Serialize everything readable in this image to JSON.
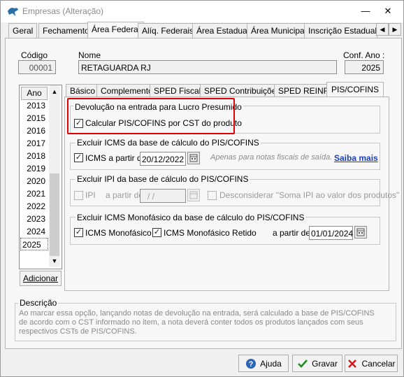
{
  "window": {
    "title": "Empresas (Alteração)"
  },
  "main_tabs": [
    {
      "label": "Geral"
    },
    {
      "label": "Fechamento"
    },
    {
      "label": "Área Federal",
      "active": true
    },
    {
      "label": "Alíq. Federais"
    },
    {
      "label": "Área Estadual"
    },
    {
      "label": "Área Municipal"
    },
    {
      "label": "Inscrição Estadual S"
    }
  ],
  "header": {
    "codigo_label": "Código",
    "codigo_value": "00001",
    "nome_label": "Nome",
    "nome_value": "RETAGUARDA RJ",
    "conf_ano_label": "Conf. Ano :",
    "conf_ano_value": "2025"
  },
  "ano_list": {
    "header": "Ano",
    "items": [
      "2013",
      "2015",
      "2016",
      "2017",
      "2018",
      "2019",
      "2020",
      "2021",
      "2022",
      "2023",
      "2024",
      "2025"
    ],
    "selected": "2025",
    "add_button": "Adicionar"
  },
  "sub_tabs": [
    {
      "label": "Básico"
    },
    {
      "label": "Complemento"
    },
    {
      "label": "SPED Fiscal"
    },
    {
      "label": "SPED Contribuições"
    },
    {
      "label": "SPED REINF"
    },
    {
      "label": "PIS/COFINS",
      "active": true
    }
  ],
  "devolucao": {
    "title": "Devolução na entrada para Lucro Presumido",
    "checkbox_label": "Calcular PIS/COFINS por CST do produto",
    "checked": true
  },
  "excluir_icms": {
    "title": "Excluir ICMS da base de cálculo do PIS/COFINS",
    "checkbox_label": "ICMS a partir de:",
    "checked": true,
    "date": "20/12/2022",
    "hint": "Apenas para notas fiscais de saída.",
    "link": "Saiba mais"
  },
  "excluir_ipi": {
    "title": "Excluir IPI da base de cálculo do PIS/COFINS",
    "checkbox_label": "IPI",
    "a_partir_label": "a partir de:",
    "date": " / /",
    "desconsiderar_label": "Desconsiderar \"Soma IPI ao valor dos produtos\""
  },
  "excluir_monofasico": {
    "title": "Excluir ICMS Monofásico da base de cálculo do PIS/COFINS",
    "cb1_label": "ICMS Monofásico",
    "cb2_label": "ICMS Monofásico Retido",
    "a_partir_label": "a partir de:",
    "date": "01/01/2024"
  },
  "descricao": {
    "title": "Descrição",
    "line1": "Ao marcar essa opção, lançando notas de devolução na entrada, será calculado a base de PIS/COFINS",
    "line2": "de acordo com o CST informado no item, a nota deverá conter todos os produtos lançados com seus",
    "line3": "respectivos CSTs de PIS/COFINS."
  },
  "buttons": {
    "ajuda": "Ajuda",
    "gravar": "Gravar",
    "cancelar": "Cancelar"
  },
  "colors": {
    "highlight": "#e00000",
    "link": "#1a3fb3"
  }
}
